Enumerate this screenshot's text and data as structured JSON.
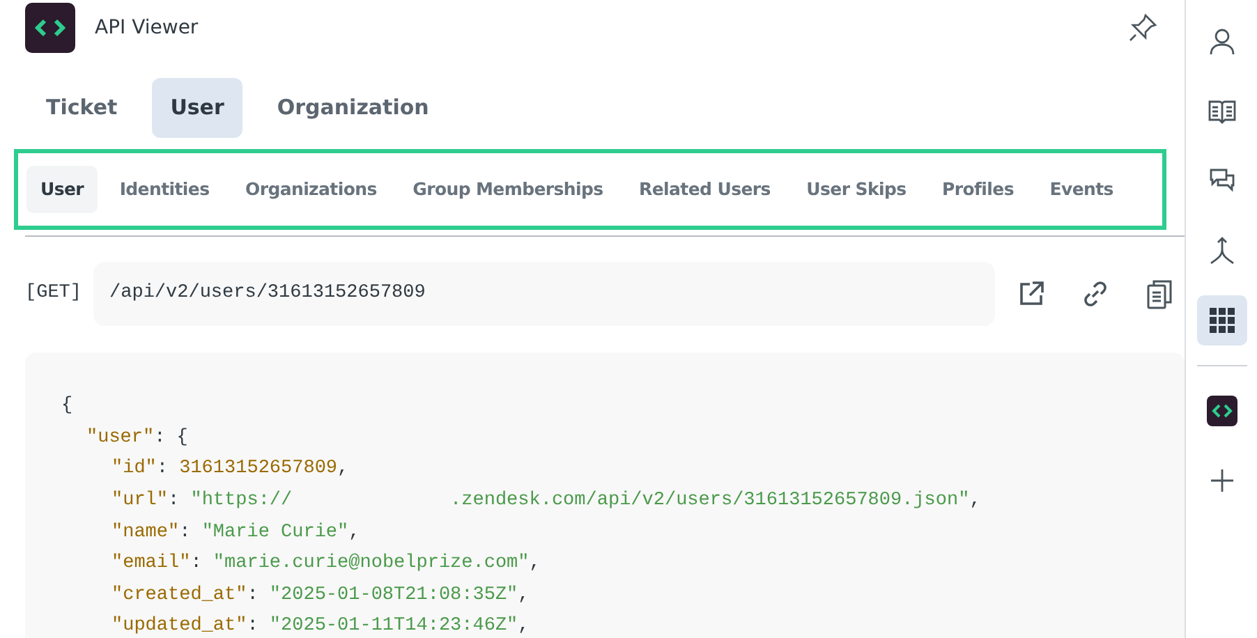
{
  "app": {
    "title": "API Viewer"
  },
  "tabs": [
    {
      "label": "Ticket",
      "selected": false
    },
    {
      "label": "User",
      "selected": true
    },
    {
      "label": "Organization",
      "selected": false
    }
  ],
  "subtabs": [
    {
      "label": "User",
      "selected": true
    },
    {
      "label": "Identities",
      "selected": false
    },
    {
      "label": "Organizations",
      "selected": false
    },
    {
      "label": "Group Memberships",
      "selected": false
    },
    {
      "label": "Related Users",
      "selected": false
    },
    {
      "label": "User Skips",
      "selected": false
    },
    {
      "label": "Profiles",
      "selected": false
    },
    {
      "label": "Events",
      "selected": false
    }
  ],
  "request": {
    "method": "[GET]",
    "path": "/api/v2/users/31613152657809"
  },
  "response": [
    {
      "kind": "brace",
      "text": "{",
      "children": [
        {
          "kind": "object",
          "key": "\"user\"",
          "text": ": {",
          "children": [
            {
              "kind": "number",
              "key": "\"id\"",
              "separator": ":",
              "value": "31613152657809",
              "trail": ","
            },
            {
              "kind": "string",
              "key": "\"url\"",
              "separator": ":",
              "value": "\"https://              .zendesk.com/api/v2/users/31613152657809.json\"",
              "trail": ","
            },
            {
              "kind": "string",
              "key": "\"name\"",
              "separator": ":",
              "value": "\"Marie Curie\"",
              "trail": ","
            },
            {
              "kind": "string",
              "key": "\"email\"",
              "separator": ":",
              "value": "\"marie.curie@nobelprize.com\"",
              "trail": ","
            },
            {
              "kind": "string",
              "key": "\"created_at\"",
              "separator": ":",
              "value": "\"2025-01-08T21:08:35Z\"",
              "trail": ","
            },
            {
              "kind": "string",
              "key": "\"updated_at\"",
              "separator": ":",
              "value": "\"2025-01-11T14:23:46Z\"",
              "trail": ","
            }
          ]
        }
      ]
    }
  ],
  "sidebar": {
    "items": [
      {
        "kind": "person",
        "selected": false
      },
      {
        "kind": "book",
        "selected": false
      },
      {
        "kind": "chat",
        "selected": false
      },
      {
        "kind": "merge",
        "selected": false
      },
      {
        "kind": "grid",
        "selected": true
      }
    ],
    "apps": [
      {
        "kind": "app"
      },
      {
        "kind": "plus"
      }
    ]
  }
}
